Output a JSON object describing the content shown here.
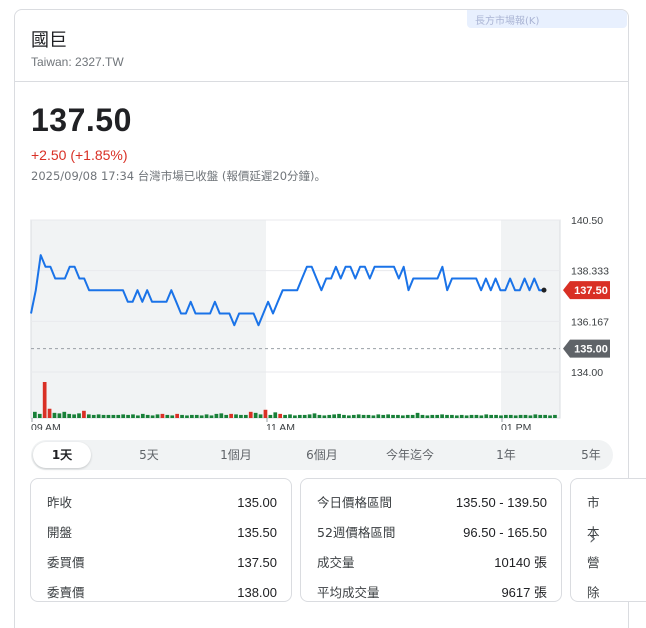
{
  "header": {
    "name": "國巨",
    "ticker": "Taiwan: 2327.TW",
    "ghost_label": "長方市場報(K)"
  },
  "quote": {
    "price": "137.50",
    "change": "+2.50 (+1.85%)",
    "timestamp": "2025/09/08 17:34 台灣市場已收盤 (報價延遲20分鐘)。"
  },
  "colors": {
    "line": "#1a73e8",
    "up": "#188038",
    "down": "#d93025",
    "shade": "#f1f3f4",
    "baseline": "#9aa0a6",
    "baseline_tag": "#5f6368"
  },
  "chart_data": {
    "type": "line",
    "y_ticks": [
      "140.50",
      "138.333",
      "136.167",
      "134.00"
    ],
    "ylim": [
      134.0,
      140.5
    ],
    "x_ticks": [
      "09 AM",
      "11 AM",
      "01 PM"
    ],
    "current_label": "137.50",
    "current_value": 137.5,
    "baseline_label": "135.00",
    "baseline_value": 135.0,
    "series": [
      {
        "values": [
          136.5,
          137.5,
          139.0,
          138.5,
          138.5,
          138.0,
          138.0,
          138.0,
          138.5,
          138.5,
          138.0,
          138.0,
          137.5,
          137.5,
          137.5,
          137.5,
          137.5,
          137.5,
          137.5,
          137.5,
          137.0,
          137.0,
          137.5,
          137.0,
          137.5,
          137.0,
          137.0,
          137.0,
          137.0,
          137.5,
          137.0,
          136.5,
          136.5,
          137.0,
          136.5,
          136.5,
          136.5,
          136.5,
          137.0,
          136.5,
          136.5,
          136.5,
          136.0,
          136.5,
          136.5,
          136.5,
          136.5,
          136.0,
          136.5,
          137.0,
          136.5,
          137.0,
          137.5,
          137.5,
          137.5,
          137.5,
          138.0,
          138.5,
          138.5,
          138.0,
          137.5,
          138.0,
          138.0,
          138.5,
          138.0,
          138.5,
          138.5,
          138.0,
          138.5,
          138.5,
          138.0,
          138.5,
          138.5,
          138.5,
          138.5,
          138.5,
          138.0,
          138.5,
          137.5,
          138.0,
          138.0,
          138.0,
          138.0,
          138.0,
          138.0,
          138.5,
          137.5,
          138.0,
          138.0,
          138.0,
          138.0,
          138.0,
          138.0,
          137.5,
          138.0,
          137.5,
          138.0,
          137.5,
          137.5,
          138.0,
          137.5,
          137.5,
          138.0,
          137.5,
          138.0,
          137.5,
          137.5
        ]
      }
    ],
    "volume": [
      12,
      8,
      70,
      18,
      10,
      9,
      12,
      8,
      7,
      9,
      14,
      7,
      6,
      7,
      6,
      6,
      6,
      6,
      7,
      6,
      7,
      5,
      8,
      6,
      5,
      7,
      8,
      6,
      5,
      8,
      6,
      5,
      6,
      6,
      5,
      7,
      5,
      8,
      9,
      6,
      8,
      7,
      6,
      6,
      12,
      10,
      7,
      16,
      6,
      11,
      8,
      6,
      7,
      5,
      6,
      6,
      7,
      9,
      6,
      5,
      6,
      7,
      8,
      6,
      5,
      6,
      7,
      6,
      6,
      5,
      7,
      6,
      7,
      6,
      6,
      5,
      6,
      6,
      10,
      6,
      5,
      6,
      6,
      7,
      6,
      6,
      5,
      6,
      5,
      6,
      6,
      5,
      7,
      6,
      6,
      5,
      6,
      6,
      5,
      6,
      6,
      5,
      7,
      6,
      6,
      5,
      6
    ],
    "volume_colors": [
      "g",
      "g",
      "r",
      "r",
      "g",
      "g",
      "g",
      "g",
      "g",
      "g",
      "r",
      "g",
      "g",
      "g",
      "g",
      "g",
      "g",
      "g",
      "g",
      "g",
      "g",
      "g",
      "g",
      "g",
      "g",
      "g",
      "r",
      "g",
      "g",
      "r",
      "g",
      "g",
      "g",
      "g",
      "g",
      "g",
      "g",
      "g",
      "g",
      "g",
      "r",
      "g",
      "g",
      "g",
      "r",
      "g",
      "g",
      "r",
      "g",
      "g",
      "r",
      "g",
      "g",
      "g",
      "g",
      "g",
      "g",
      "g",
      "g",
      "g",
      "g",
      "g",
      "g",
      "g",
      "g",
      "g",
      "g",
      "g",
      "g",
      "g",
      "g",
      "g",
      "g",
      "g",
      "g",
      "g",
      "g",
      "g",
      "g",
      "g",
      "g",
      "g",
      "g",
      "g",
      "g",
      "g",
      "g",
      "g",
      "g",
      "g",
      "g",
      "g",
      "g",
      "g",
      "g",
      "g",
      "g",
      "g",
      "g",
      "g",
      "g",
      "g",
      "g",
      "g",
      "g",
      "g",
      "g"
    ]
  },
  "tabs": [
    "1天",
    "5天",
    "1個月",
    "6個月",
    "今年迄今",
    "1年",
    "5年"
  ],
  "stats_left": [
    {
      "label": "昨收",
      "value": "135.00"
    },
    {
      "label": "開盤",
      "value": "135.50"
    },
    {
      "label": "委買價",
      "value": "137.50"
    },
    {
      "label": "委賣價",
      "value": "138.00"
    }
  ],
  "stats_mid": [
    {
      "label": "今日價格區間",
      "value": "135.50 - 139.50"
    },
    {
      "label": "52週價格區間",
      "value": "96.50 - 165.50"
    },
    {
      "label": "成交量",
      "value": "10140 張"
    },
    {
      "label": "平均成交量",
      "value": "9617 張"
    }
  ],
  "stats_right": [
    {
      "label": "市"
    },
    {
      "label": "本"
    },
    {
      "label": "營"
    },
    {
      "label": "除"
    }
  ]
}
